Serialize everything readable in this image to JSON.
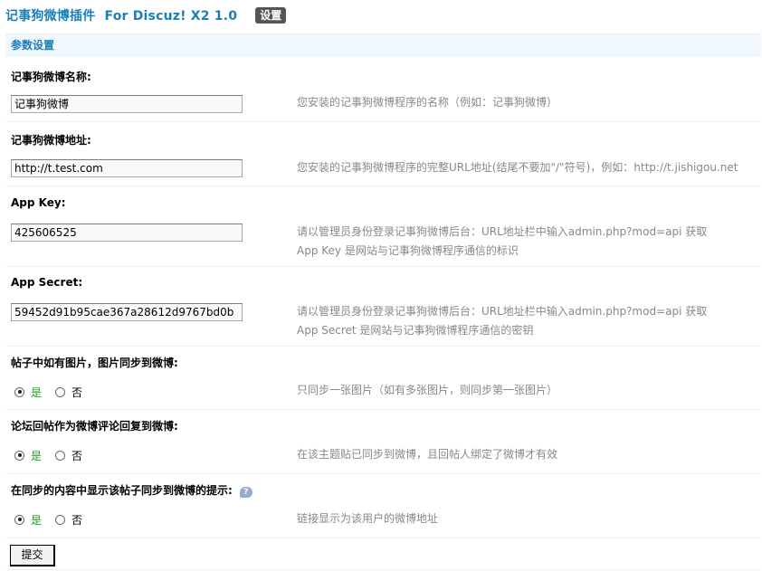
{
  "header": {
    "title": "记事狗微博插件  For Discuz! X2 1.0",
    "settings_label": "设置"
  },
  "section": {
    "title": "参数设置"
  },
  "fields": {
    "name": {
      "label": "记事狗微博名称:",
      "value": "记事狗微博",
      "desc": "您安装的记事狗微博程序的名称（例如：记事狗微博）"
    },
    "url": {
      "label": "记事狗微博地址:",
      "value": "http://t.test.com",
      "desc": "您安装的记事狗微博程序的完整URL地址(结尾不要加\"/\"符号)，例如：http://t.jishigou.net"
    },
    "app_key": {
      "label": "App Key:",
      "value": "425606525",
      "desc_line1": "请以管理员身份登录记事狗微博后台：URL地址栏中输入admin.php?mod=api 获取",
      "desc_line2": "App Key 是网站与记事狗微博程序通信的标识"
    },
    "app_secret": {
      "label": "App Secret:",
      "value": "59452d91b95cae367a28612d9767bd0b",
      "desc_line1": "请以管理员身份登录记事狗微博后台：URL地址栏中输入admin.php?mod=api 获取",
      "desc_line2": "App Secret 是网站与记事狗微博程序通信的密钥"
    }
  },
  "options": {
    "sync_images": {
      "label": "帖子中如有图片，图片同步到微博:",
      "yes": "是",
      "no": "否",
      "selected": "yes",
      "desc": "只同步一张图片（如有多张图片，则同步第一张图片）"
    },
    "reply_as_comment": {
      "label": "论坛回帖作为微博评论回复到微博:",
      "yes": "是",
      "no": "否",
      "selected": "yes",
      "desc": "在该主题贴已同步到微博，且回帖人绑定了微博才有效"
    },
    "show_sync_tip": {
      "label": "在同步的内容中显示该帖子同步到微博的提示:",
      "help_icon": "question-bubble-icon",
      "help_glyph": "?",
      "yes": "是",
      "no": "否",
      "selected": "yes",
      "desc": "链接显示为该用户的微博地址"
    }
  },
  "submit_label": "提交",
  "colors": {
    "title_blue": "#1a7fb9",
    "section_bg": "#f0f7fd",
    "yes_green": "#1f9c2a",
    "desc_gray": "#888888"
  }
}
